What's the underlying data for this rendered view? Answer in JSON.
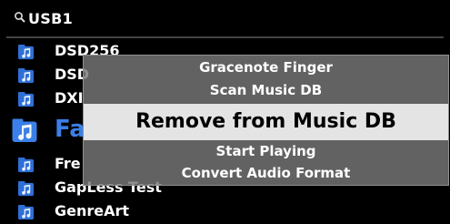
{
  "header": {
    "title": "USB1",
    "icon": "search-icon"
  },
  "list": {
    "items": [
      {
        "label": "DSD256",
        "icon": "music-folder-icon"
      },
      {
        "label": "DSD",
        "icon": "music-folder-icon"
      },
      {
        "label": "DXI",
        "icon": "music-folder-icon"
      },
      {
        "label": "Fa",
        "icon": "music-folder-icon",
        "selected": true
      },
      {
        "label": "Fre",
        "icon": "music-folder-icon"
      },
      {
        "label": "GapLess Test",
        "icon": "music-folder-icon"
      },
      {
        "label": "GenreArt",
        "icon": "music-folder-icon"
      }
    ]
  },
  "popup": {
    "items": [
      {
        "label": "Gracenote Finger"
      },
      {
        "label": "Scan Music DB"
      },
      {
        "label": "Remove from Music DB",
        "active": true
      },
      {
        "label": "Start Playing"
      },
      {
        "label": "Convert Audio Format"
      }
    ]
  },
  "colors": {
    "background": "#000000",
    "selected_text": "#3b7fe8",
    "icon_blue": "#2f6fd6",
    "popup_bg": "#787878",
    "popup_highlight": "#e4e4e4"
  }
}
